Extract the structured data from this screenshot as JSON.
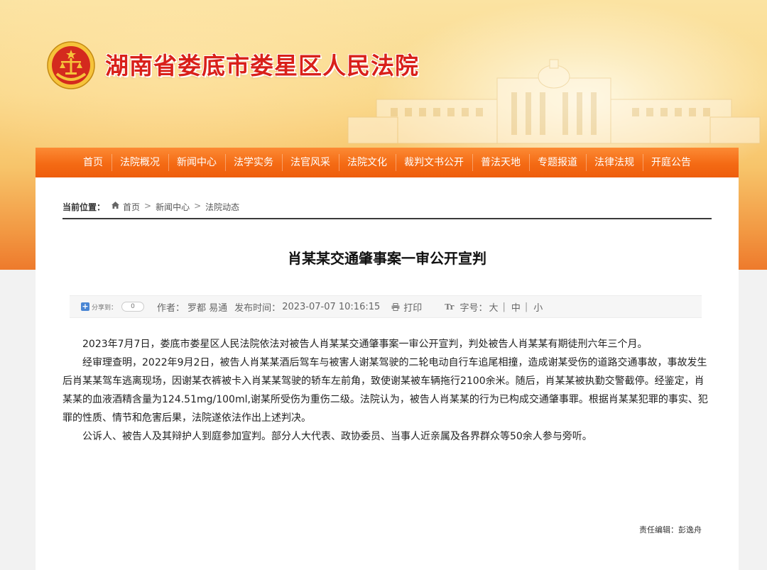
{
  "header": {
    "court_name": "湖南省娄底市娄星区人民法院",
    "emblem_icon": "court-emblem-icon",
    "accent_color": "#d9201a"
  },
  "nav": {
    "items": [
      "首页",
      "法院概况",
      "新闻中心",
      "法学实务",
      "法官风采",
      "法院文化",
      "裁判文书公开",
      "普法天地",
      "专题报道",
      "法律法规",
      "开庭公告"
    ],
    "color": "#f46a14"
  },
  "breadcrumb": {
    "label": "当前位置：",
    "items": [
      "首页",
      "新闻中心",
      "法院动态"
    ],
    "separator": ">"
  },
  "article": {
    "title": "肖某某交通肇事案一审公开宣判",
    "meta": {
      "share_label": "分享到：",
      "share_count": "0",
      "author_label": "作者：",
      "author": "罗都 易通",
      "time_label": "发布时间：",
      "time": "2023-07-07 10:16:15",
      "print_label": "打印",
      "font_label": "字号：",
      "font_large": "大",
      "font_medium": "中",
      "font_small": "小",
      "font_sep": "|"
    },
    "paragraphs": [
      "2023年7月7日，娄底市娄星区人民法院依法对被告人肖某某交通肇事案一审公开宣判，判处被告人肖某某有期徒刑六年三个月。",
      "经审理查明，2022年9月2日，被告人肖某某酒后驾车与被害人谢某驾驶的二轮电动自行车追尾相撞，造成谢某受伤的道路交通事故，事故发生后肖某某驾车逃离现场，因谢某衣裤被卡入肖某某驾驶的轿车左前角，致使谢某被车辆拖行2100余米。随后，肖某某被执勤交警截停。经鉴定，肖某某的血液酒精含量为124.51mg/100ml,谢某所受伤为重伤二级。法院认为，被告人肖某某的行为已构成交通肇事罪。根据肖某某犯罪的事实、犯罪的性质、情节和危害后果，法院遂依法作出上述判决。",
      "公诉人、被告人及其辩护人到庭参加宣判。部分人大代表、政协委员、当事人近亲属及各界群众等50余人参与旁听。"
    ],
    "editor": "责任编辑：彭逸舟"
  }
}
